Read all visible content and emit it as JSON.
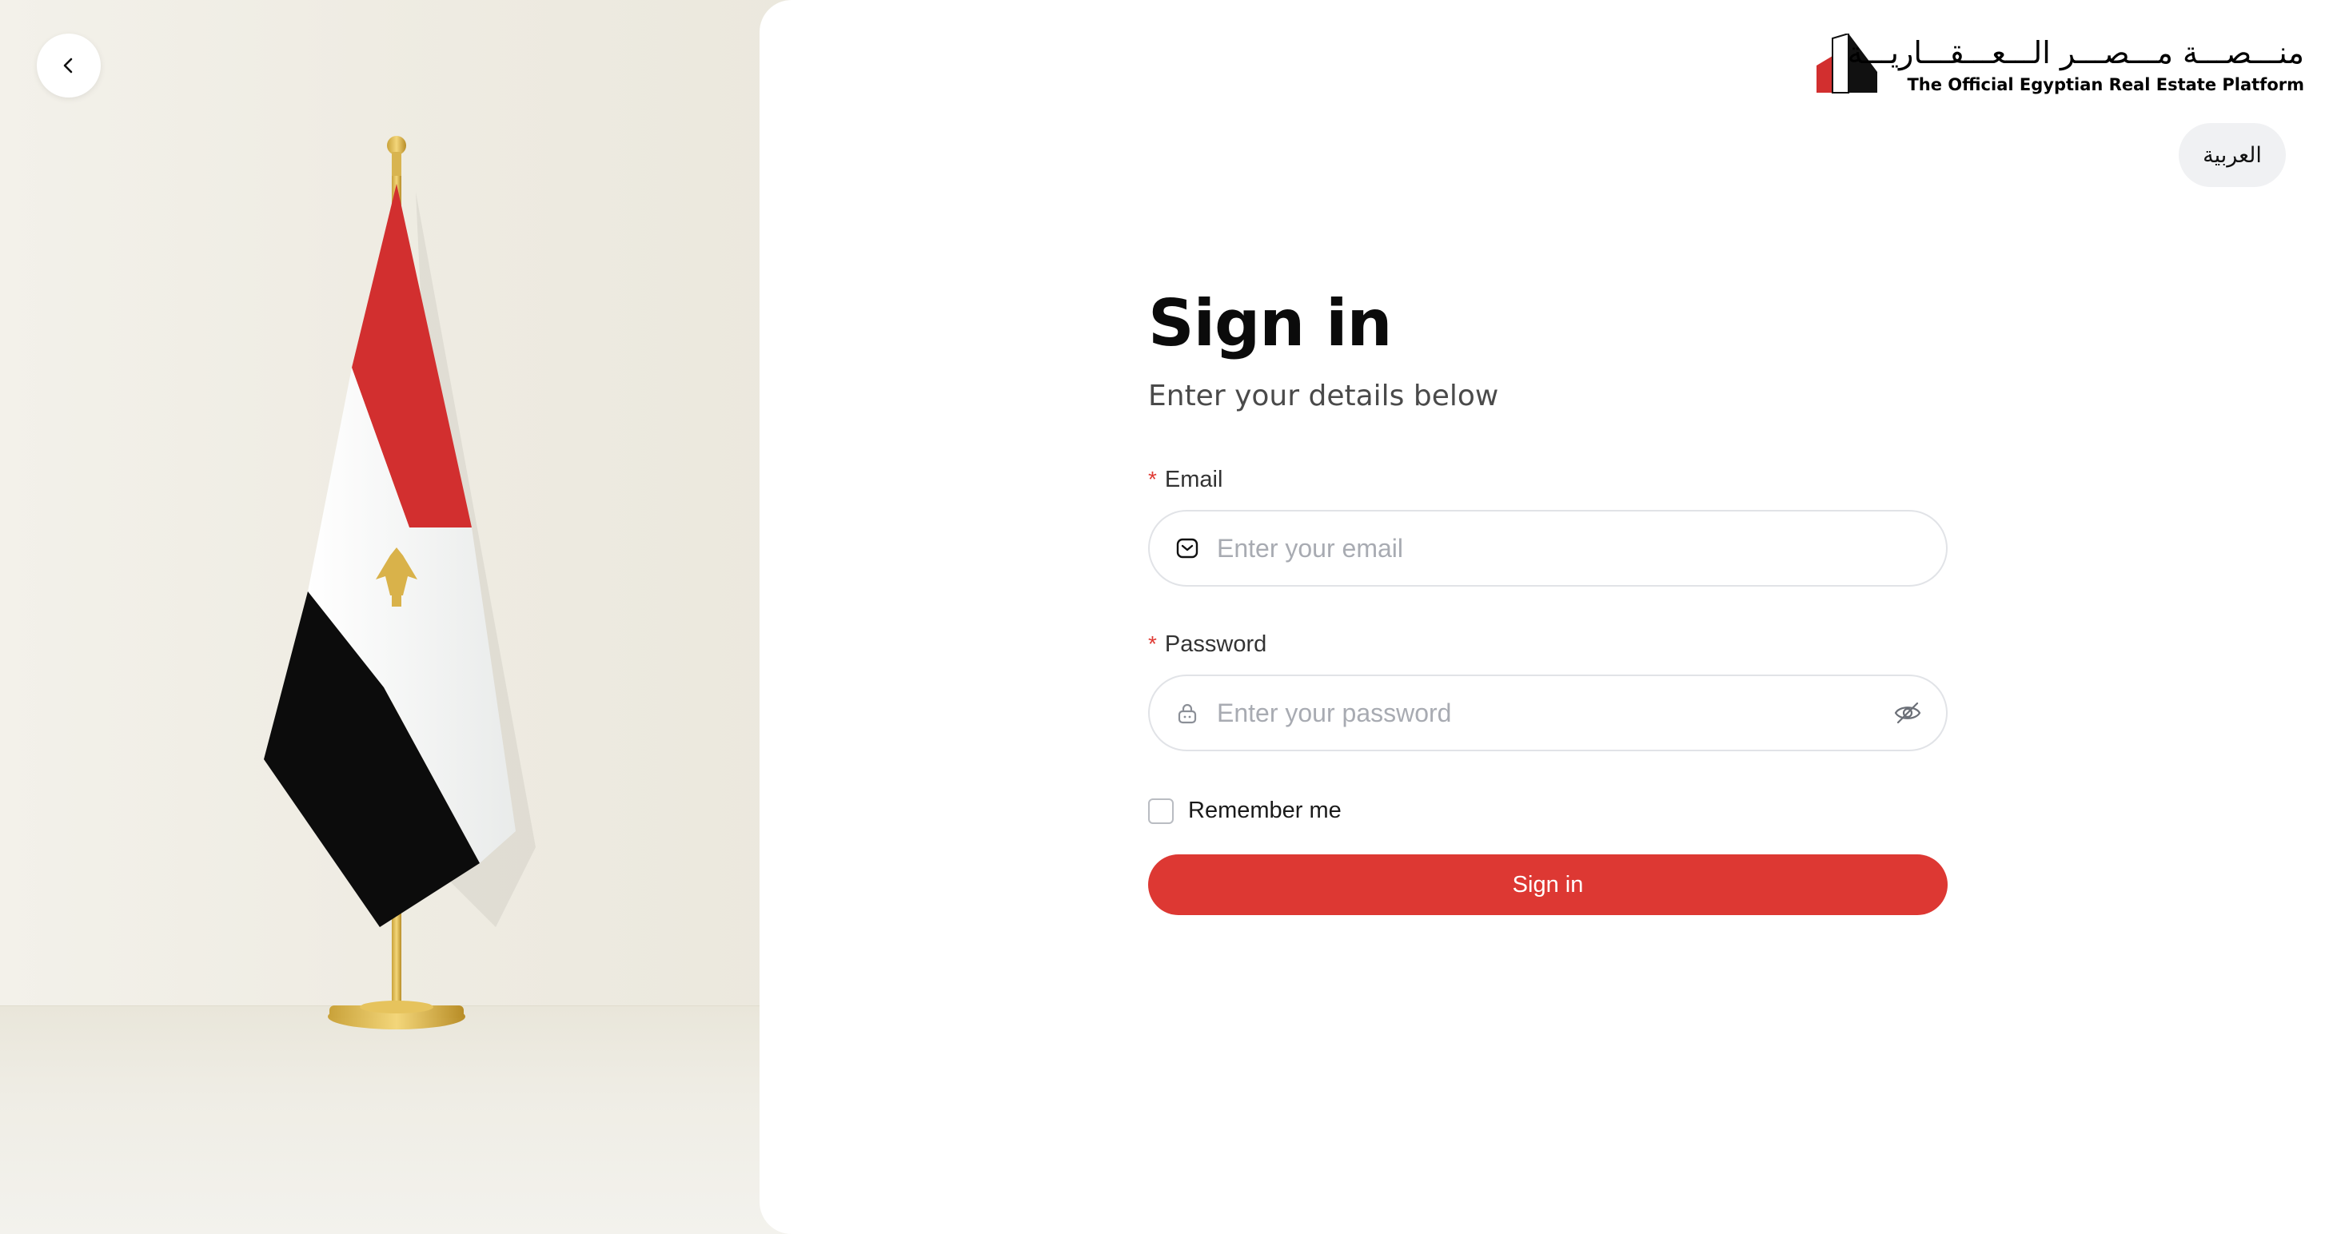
{
  "back_button": {
    "icon": "chevron-left-icon"
  },
  "logo": {
    "arabic_text": "منـــصـــة مـــصـــر الـــعـــقـــاريـــة",
    "english_text": "The Official Egyptian Real Estate Platform"
  },
  "language_toggle": {
    "label": "العربية"
  },
  "form": {
    "title": "Sign in",
    "subtitle": "Enter your details below",
    "email": {
      "required_mark": "*",
      "label": "Email",
      "placeholder": "Enter your email",
      "value": "",
      "icon": "mail-icon"
    },
    "password": {
      "required_mark": "*",
      "label": "Password",
      "placeholder": "Enter your password",
      "value": "",
      "icon": "lock-icon",
      "toggle_icon": "eye-off-icon"
    },
    "remember_me": {
      "label": "Remember me",
      "checked": false
    },
    "submit_label": "Sign in"
  },
  "colors": {
    "accent": "#dd3833",
    "input_border": "#e1e3e7",
    "language_bg": "#f0f1f3"
  }
}
